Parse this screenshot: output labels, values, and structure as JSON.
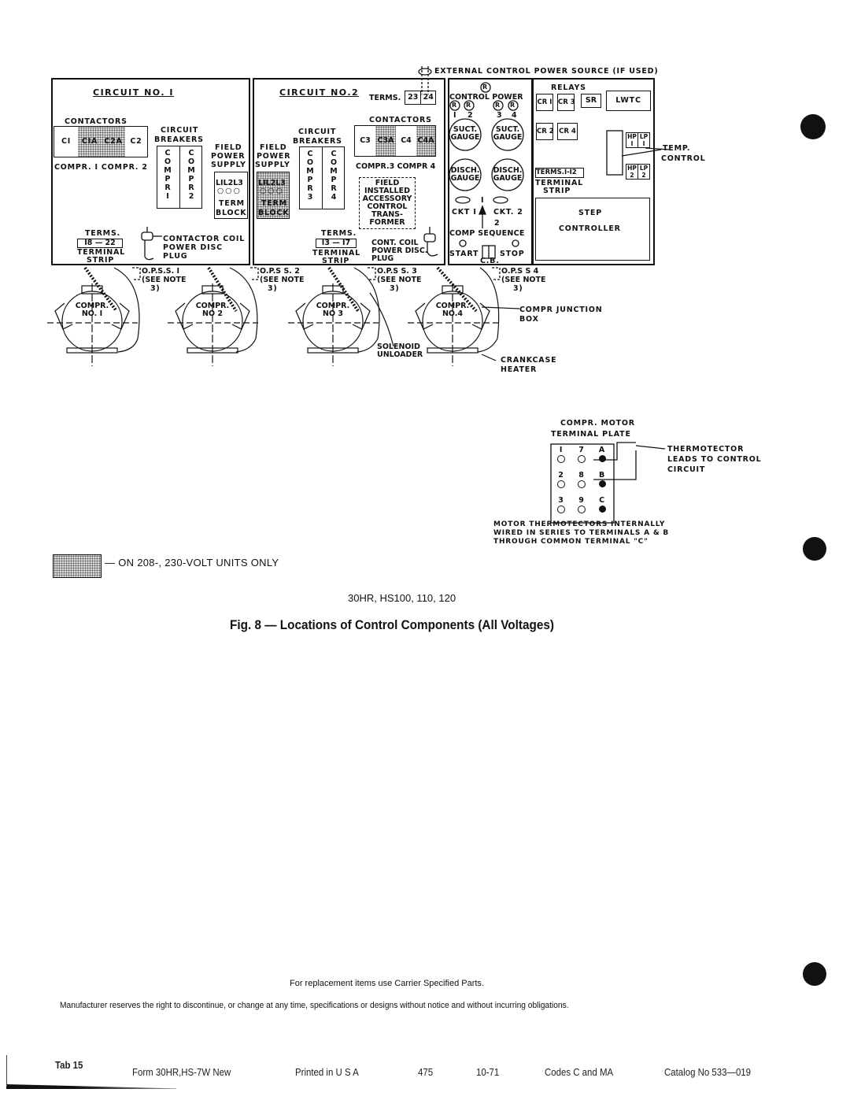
{
  "external_power": "EXTERNAL CONTROL POWER SOURCE (IF USED)",
  "circuit1": {
    "title": "CIRCUIT NO. I",
    "contactors_label": "CONTACTORS",
    "contactors": [
      "CI",
      "CIA",
      "C2A",
      "C2"
    ],
    "compr_labels": "COMPR. I COMPR. 2",
    "breakers_label_1": "CIRCUIT",
    "breakers_label_2": "BREAKERS",
    "breaker_a": "C\nO\nM\nP\nR\nI",
    "breaker_b": "C\nO\nM\nP\nR\n2",
    "field_label_1": "FIELD",
    "field_label_2": "POWER",
    "field_label_3": "SUPPLY",
    "term_lines": "LIL2L3",
    "term_circles": "○○○",
    "term_block_1": "TERM",
    "term_block_2": "BLOCK",
    "terms_label": "TERMS.",
    "terms_range": "I8 — 22",
    "terminal_label": "TERMINAL",
    "strip_label": "STRIP",
    "plug_1": "CONTACTOR COIL",
    "plug_2": "POWER DISC",
    "plug_3": "PLUG"
  },
  "circuit2": {
    "title": "CIRCUIT NO.2",
    "terms_label": "TERMS.",
    "terms": [
      "23",
      "24"
    ],
    "contactors_label": "CONTACTORS",
    "contactors": [
      "C3",
      "C3A",
      "C4",
      "C4A"
    ],
    "compr_labels": "COMPR.3 COMPR 4",
    "breakers_label_1": "CIRCUIT",
    "breakers_label_2": "BREAKERS",
    "breaker_a": "C\nO\nM\nP\nR\n3",
    "breaker_b": "C\nO\nM\nP\nR\n4",
    "field_label_1": "FIELD",
    "field_label_2": "POWER",
    "field_label_3": "SUPPLY",
    "term_lines": "LIL2L3",
    "term_circles": "○○○",
    "term_block_1": "TERM",
    "term_block_2": "BLOCK",
    "accessory": [
      "FIELD",
      "INSTALLED",
      "ACCESSORY",
      "CONTROL",
      "TRANS-",
      "FORMER"
    ],
    "terms2_label": "TERMS.",
    "terms2_range": "I3 — I7",
    "terminal_label": "TERMINAL",
    "strip_label": "STRIP",
    "plug_1": "CONT. COIL",
    "plug_2": "POWER DISC.",
    "plug_3": "PLUG"
  },
  "control_panel": {
    "control_power": "CONTROL POWER",
    "r": "R",
    "r_numbers": [
      "I",
      "2",
      "3",
      "4"
    ],
    "suct_gauge": [
      "SUCT.",
      "GAUGE"
    ],
    "disch_gauge": [
      "DISCH.",
      "GAUGE"
    ],
    "ckt1": "CKT I",
    "ckt2": "CKT. 2",
    "seq_1": "I",
    "seq_2": "2",
    "comp_sequence": "COMP SEQUENCE",
    "start": "START",
    "stop": "STOP",
    "cb": "C.B."
  },
  "relay_panel": {
    "relays_label": "RELAYS",
    "relays_row1": [
      "CR I",
      "CR 3",
      "SR"
    ],
    "lwtc": "LWTC",
    "relays_row2": [
      "CR 2",
      "CR 4"
    ],
    "hplp1": [
      "HP I",
      "LP I"
    ],
    "hplp2": [
      "HP 2",
      "LP 2"
    ],
    "terms": "TERMS.I-I2",
    "terminal_label": "TERMINAL",
    "strip_label": "STRIP",
    "step_1": "STEP",
    "step_2": "CONTROLLER",
    "temp_1": "TEMP.",
    "temp_2": "CONTROL"
  },
  "compressors": [
    {
      "name1": "COMPR.",
      "name2": "NO. I",
      "opss": "O.P.S.S. I"
    },
    {
      "name1": "COMPR.",
      "name2": "NO 2",
      "opss": "O.P.S S. 2"
    },
    {
      "name1": "COMPR.",
      "name2": "NO 3",
      "opss": "O.P.S S. 3"
    },
    {
      "name1": "COMPR.",
      "name2": "NO.4",
      "opss": "O.P.S S 4"
    }
  ],
  "see_note_1": "(SEE NOTE",
  "see_note_2": "3)",
  "junction_1": "COMPR JUNCTION",
  "junction_2": "BOX",
  "solenoid_1": "SOLENOID",
  "solenoid_2": "UNLOADER",
  "crankcase_1": "CRANKCASE",
  "crankcase_2": "HEATER",
  "motor_plate": {
    "title_1": "COMPR. MOTOR",
    "title_2": "TERMINAL  PLATE",
    "terminals": [
      [
        "I",
        "7",
        "A"
      ],
      [
        "2",
        "8",
        "B"
      ],
      [
        "3",
        "9",
        "C"
      ]
    ],
    "leads_1": "THERMOTECTOR",
    "leads_2": "LEADS  TO CONTROL",
    "leads_3": "CIRCUIT",
    "note_1": "MOTOR THERMOTECTORS  INTERNALLY",
    "note_2": "WIRED IN SERIES TO TERMINALS A & B",
    "note_3": "THROUGH  COMMON  TERMINAL \"C\""
  },
  "legend_text": "— ON 208-, 230-VOLT UNITS ONLY",
  "models": "30HR, HS100, 110, 120",
  "figure_caption": "Fig. 8 — Locations of Control Components (All Voltages)",
  "replacement_note": "For replacement items use Carrier Specified Parts.",
  "disclaimer": "Manufacturer reserves the right to discontinue, or change at any time, specifications or designs without notice and without incurring obligations.",
  "footer": {
    "tab": "Tab 15",
    "form": "Form 30HR,HS-7W  New",
    "printed": "Printed in U S A",
    "number": "475",
    "date": "10-71",
    "codes": "Codes C and MA",
    "catalog": "Catalog No  533—019"
  }
}
